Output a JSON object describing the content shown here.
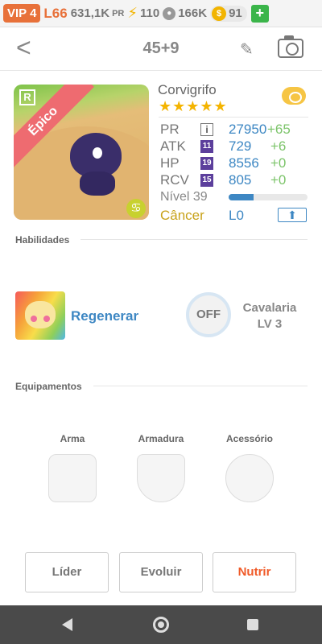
{
  "statusbar": {
    "vip": "VIP 4",
    "level": "L66",
    "power": "631,1K",
    "power_unit": "PR",
    "energy": "110",
    "paw_count": "166K",
    "coins": "91",
    "plus_label": "+",
    "accent": "#e8713a"
  },
  "header": {
    "title": "45+9",
    "back_label": "<",
    "edit_label": "✎"
  },
  "card": {
    "rarity": "Épico",
    "rank": "R",
    "zodiac_symbol": "♋",
    "name": "Corvigrifo",
    "stars": "★★★★★",
    "stats": [
      {
        "label": "PR",
        "icon": "i",
        "value": "27950",
        "bonus": "+65"
      },
      {
        "label": "ATK",
        "icon": "11",
        "value": "729",
        "bonus": "+6"
      },
      {
        "label": "HP",
        "icon": "19",
        "value": "8556",
        "bonus": "+0"
      },
      {
        "label": "RCV",
        "icon": "15",
        "value": "805",
        "bonus": "+0"
      }
    ],
    "level_label": "Nível 39",
    "xp_fraction": 0.32,
    "element": "Câncer",
    "element_level": "L0",
    "upgrade_icon": "⬆"
  },
  "sections": {
    "skills": "Habilidades",
    "equipment": "Equipamentos"
  },
  "skills": {
    "active_name": "Regenerar",
    "passive_badge": "OFF",
    "passive_name": "Cavalaria",
    "passive_level": "LV 3"
  },
  "equipment": {
    "weapon": "Arma",
    "armor": "Armadura",
    "accessory": "Acessório"
  },
  "buttons": {
    "leader": "Líder",
    "evolve": "Evoluir",
    "feed": "Nutrir"
  },
  "colors": {
    "accent_blue": "#3d87c3",
    "bonus_green": "#7cc46a",
    "feed_orange": "#f05a28",
    "star_gold": "#f4b400"
  }
}
